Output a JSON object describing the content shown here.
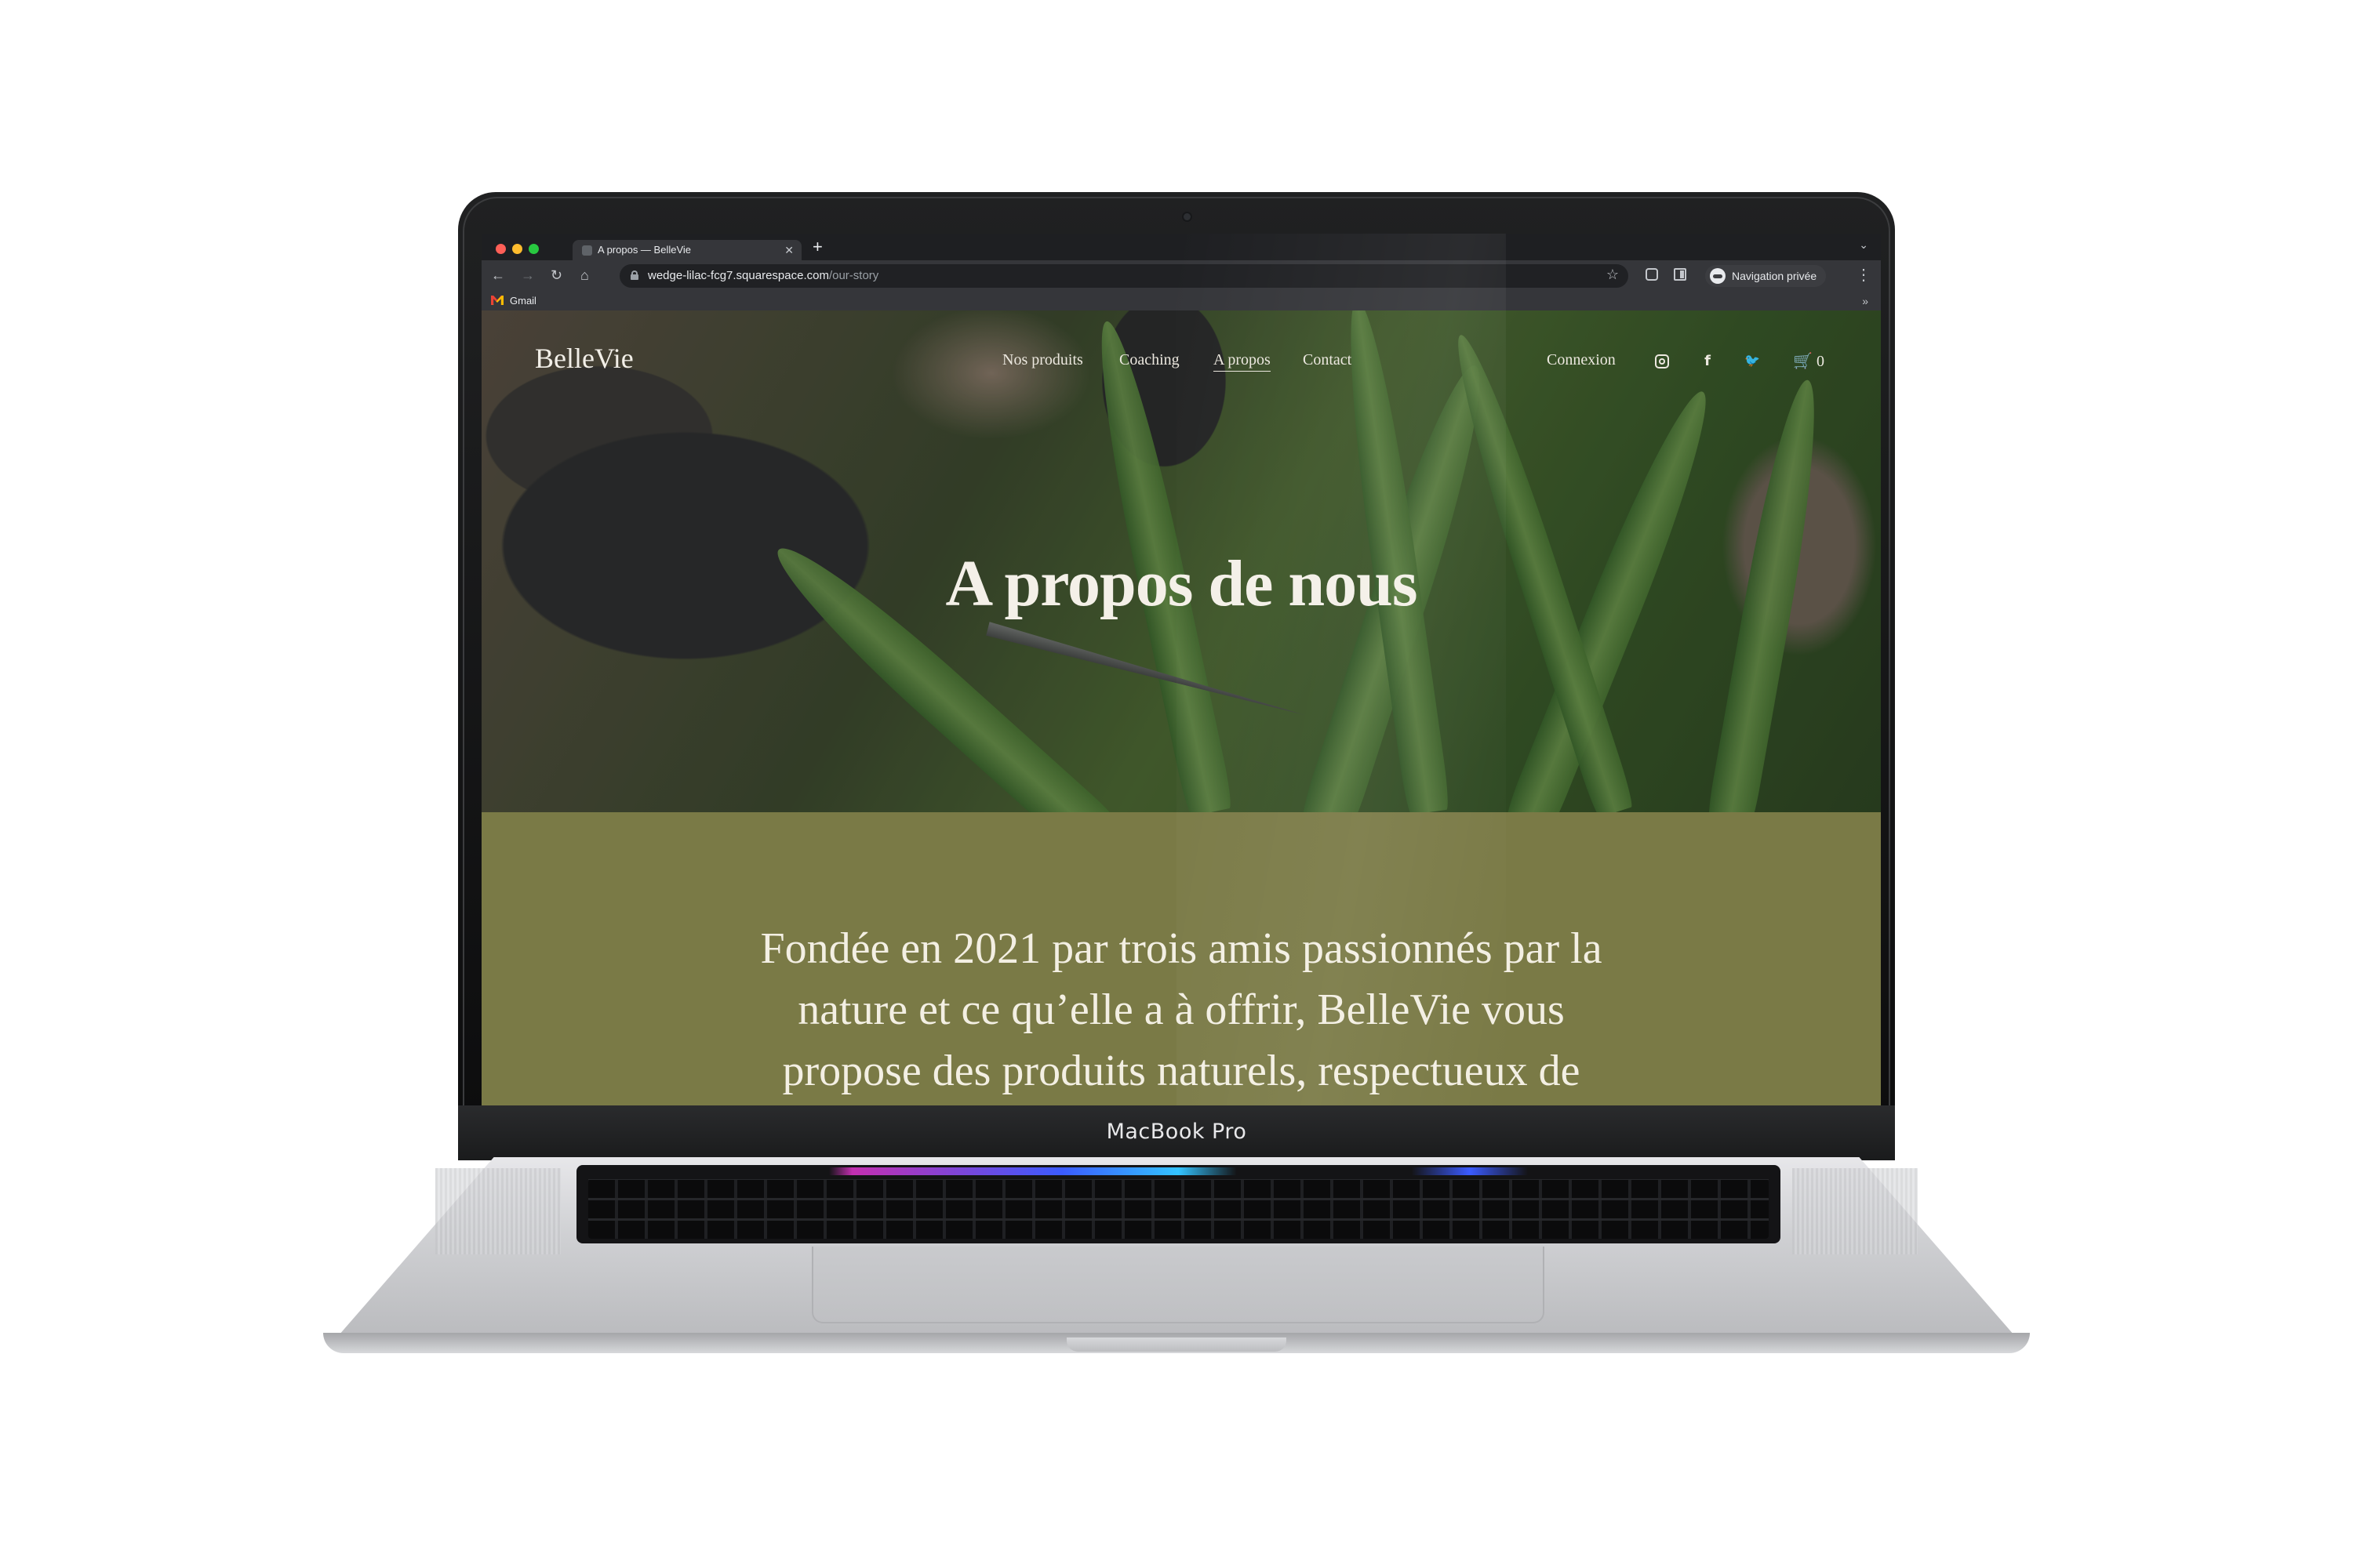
{
  "laptop": {
    "model_label": "MacBook Pro"
  },
  "browser": {
    "tab": {
      "title": "A propos — BelleVie",
      "close_icon": "close-icon"
    },
    "new_tab_label": "+",
    "address": {
      "host": "wedge-lilac-fcg7.squarespace.com",
      "path": "/our-story"
    },
    "profile_label": "Navigation privée",
    "bookmarks": [
      {
        "label": "Gmail"
      }
    ],
    "bookmarks_more": "»",
    "window_dot_colors": [
      "#ff5f57",
      "#febc2e",
      "#28c840"
    ]
  },
  "site": {
    "logo": "BelleVie",
    "nav": [
      {
        "label": "Nos produits"
      },
      {
        "label": "Coaching"
      },
      {
        "label": "A propos",
        "active": true
      },
      {
        "label": "Contact"
      }
    ],
    "login_label": "Connexion",
    "social_icons": [
      "instagram-icon",
      "facebook-icon",
      "twitter-icon"
    ],
    "cart_count": "0",
    "hero_title": "A propos de nous",
    "story_lines": [
      "Fondée en 2021 par trois amis passionnés par la",
      "nature et ce qu’elle a à offrir, BelleVie vous",
      "propose des produits naturels, respectueux de"
    ],
    "colors": {
      "story_background": "#7a7a46",
      "text_light": "#f4f0e8"
    }
  }
}
